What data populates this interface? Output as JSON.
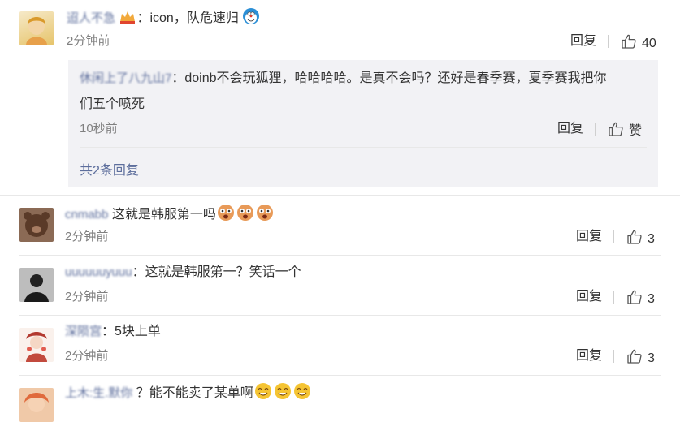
{
  "comments": [
    {
      "user": "迢人不急",
      "text": "：icon，队危速归",
      "time": "2分钟前",
      "reply": "回复",
      "likes": "40"
    },
    {
      "user": "cnmabb",
      "text": "这就是韩服第一吗",
      "time": "2分钟前",
      "reply": "回复",
      "likes": "3"
    },
    {
      "user": "uuuuuuyuuu",
      "text": "：这就是韩服第一？笑话一个",
      "time": "2分钟前",
      "reply": "回复",
      "likes": "3"
    },
    {
      "user": "深陨宫",
      "text": "：5块上单",
      "time": "2分钟前",
      "reply": "回复",
      "likes": "3"
    },
    {
      "user": "上木:生.默你",
      "text": "？能不能卖了某单啊"
    }
  ],
  "subreply": {
    "user": "休闲上了八九山7",
    "text_line1": "：doinb不会玩狐狸，哈哈哈哈。是真不会吗？还好是春季赛，夏季赛我把你",
    "text_line2": "们五个喷死",
    "time": "10秒前",
    "reply": "回复",
    "like_label": "赞",
    "more": "共2条回复"
  },
  "colors": {
    "username": "#5d6e9c",
    "text": "#333333",
    "muted": "#808080",
    "subbox_bg": "#f2f2f5"
  },
  "icons": {
    "like": "thumbs-up-icon",
    "emoji_face": "doraemon-emoji-icon",
    "emoji_scared": "scared-face-emoji-icon",
    "emoji_smile": "smile-emoji-icon",
    "badge": "vip-badge-icon"
  }
}
